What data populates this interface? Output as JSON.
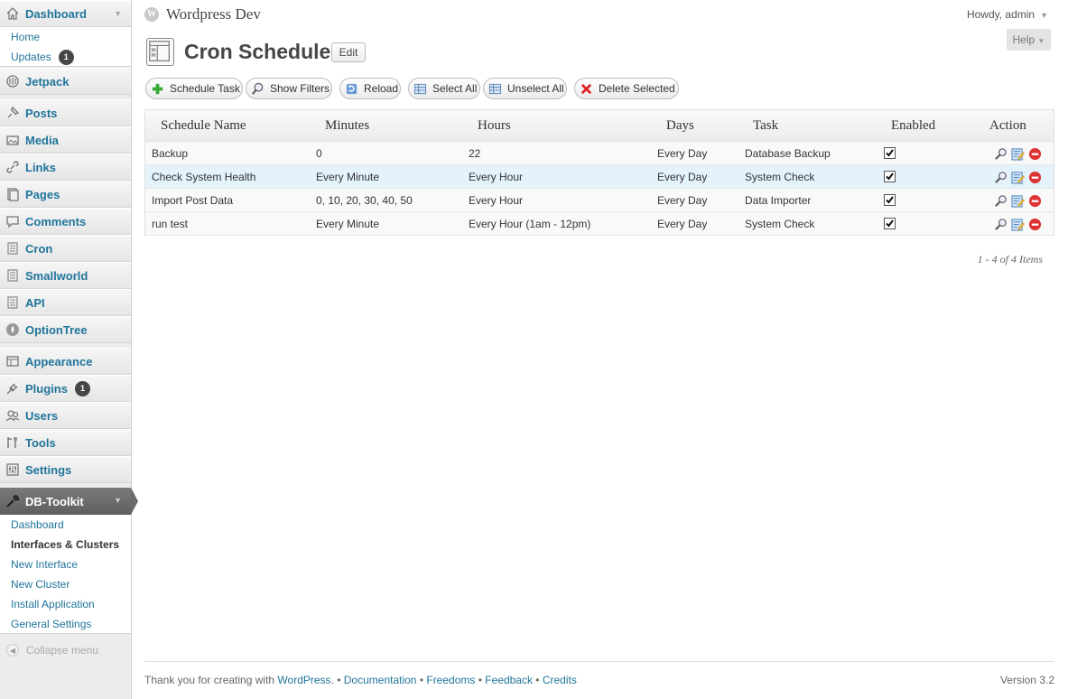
{
  "header": {
    "site_title": "Wordpress Dev",
    "wp_logo": "W",
    "howdy": "Howdy, admin",
    "help": "Help"
  },
  "sidebar": {
    "dashboard": "Dashboard",
    "home": "Home",
    "updates": "Updates",
    "updates_count": "1",
    "jetpack": "Jetpack",
    "posts": "Posts",
    "media": "Media",
    "links": "Links",
    "pages": "Pages",
    "comments": "Comments",
    "cron": "Cron",
    "smallworld": "Smallworld",
    "api": "API",
    "optiontree": "OptionTree",
    "appearance": "Appearance",
    "plugins": "Plugins",
    "plugins_count": "1",
    "users": "Users",
    "tools": "Tools",
    "settings": "Settings",
    "dbtoolkit": "DB-Toolkit",
    "dbtoolkit_sub": [
      "Dashboard",
      "Interfaces & Clusters",
      "New Interface",
      "New Cluster",
      "Install Application",
      "General Settings"
    ],
    "collapse": "Collapse menu"
  },
  "page": {
    "title": "Cron Schedule",
    "edit": "Edit"
  },
  "toolbar": {
    "schedule_task": "Schedule Task",
    "show_filters": "Show Filters",
    "reload": "Reload",
    "select_all": "Select All",
    "unselect_all": "Unselect All",
    "delete_selected": "Delete Selected"
  },
  "table": {
    "columns": [
      "Schedule Name",
      "Minutes",
      "Hours",
      "Days",
      "Task",
      "Enabled",
      "Action"
    ],
    "rows": [
      {
        "name": "Backup",
        "minutes": "0",
        "hours": "22",
        "days": "Every Day",
        "task": "Database Backup",
        "enabled": true
      },
      {
        "name": "Check System Health",
        "minutes": "Every Minute",
        "hours": "Every Hour",
        "days": "Every Day",
        "task": "System Check",
        "enabled": true
      },
      {
        "name": "Import Post Data",
        "minutes": "0, 10, 20, 30, 40, 50",
        "hours": "Every Hour",
        "days": "Every Day",
        "task": "Data Importer",
        "enabled": true
      },
      {
        "name": "run test",
        "minutes": "Every Minute",
        "hours": "Every Hour (1am - 12pm)",
        "days": "Every Day",
        "task": "System Check",
        "enabled": true
      }
    ],
    "pager": "1 - 4 of 4 Items"
  },
  "footer": {
    "thanks": "Thank you for creating with",
    "wordpress": "WordPress",
    "documentation": "Documentation",
    "freedoms": "Freedoms",
    "feedback": "Feedback",
    "credits": "Credits",
    "version": "Version 3.2"
  },
  "colors": {
    "link": "#21759b",
    "highlight_row": "#e4f2fc",
    "active_menu": "#6b6b6b",
    "delete_red": "#d22"
  }
}
